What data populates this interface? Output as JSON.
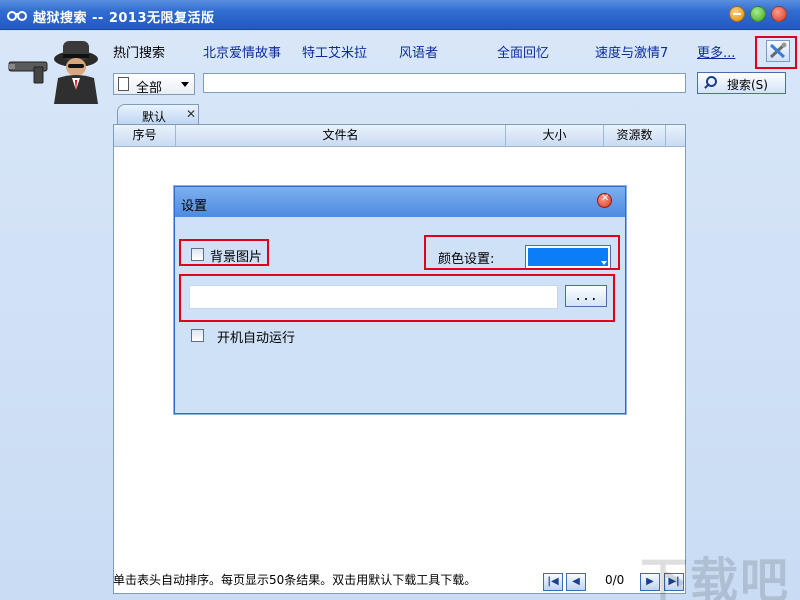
{
  "window": {
    "title": "越狱搜索 -- 2013无限复活版",
    "controls": [
      "minimize",
      "maximize",
      "close"
    ]
  },
  "hot_search": {
    "label": "热门搜索",
    "links": [
      "北京爱情故事",
      "特工艾米拉",
      "风语者",
      "全面回忆",
      "速度与激情7"
    ],
    "more": "更多..."
  },
  "search": {
    "scope_value": "全部",
    "query": "",
    "button_label": "搜索(S)"
  },
  "tabs": [
    {
      "label": "默认",
      "close": "✕"
    }
  ],
  "results_table": {
    "columns": [
      "序号",
      "文件名",
      "大小",
      "资源数"
    ],
    "rows": []
  },
  "status": {
    "hint": "单击表头自动排序。每页显示50条结果。双击用默认下载工具下载。",
    "page_indicator": "0/0"
  },
  "watermark": "下载吧",
  "settings_dialog": {
    "title": "设置",
    "background_image_label": "背景图片",
    "background_image_checked": false,
    "color_label": "颜色设置:",
    "color_value": "#0a7df7",
    "path_value": "",
    "browse_label": "...",
    "autostart_label": "开机自动运行",
    "autostart_checked": false
  },
  "colors": {
    "titlebar": "#2f6cd1",
    "highlight": "#e0001b",
    "link": "#0b2d9c"
  }
}
